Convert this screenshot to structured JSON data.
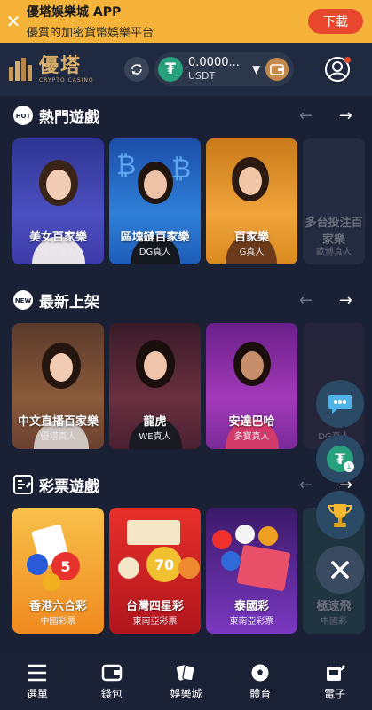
{
  "banner": {
    "title": "優塔娛樂城 APP",
    "subtitle": "優質的加密貨幣娛樂平台",
    "download_label": "下載"
  },
  "header": {
    "brand_name": "優塔",
    "brand_tagline": "CRYPTO CASINO",
    "balance": "0.0000...",
    "currency": "USDT"
  },
  "sections": [
    {
      "title": "熱門遊戲",
      "badge": "HOT",
      "cards": [
        {
          "name": "美女百家樂",
          "provider": "優塔真人",
          "bg": "#3b3fa8"
        },
        {
          "name": "區塊鏈百家樂",
          "provider": "DG真人",
          "bg": "#1f5fb8"
        },
        {
          "name": "百家樂",
          "provider": "G真人",
          "bg": "#d98a1f"
        },
        {
          "name": "多台投注百家樂",
          "provider": "歐博真人",
          "bg": "#3a3f55"
        }
      ]
    },
    {
      "title": "最新上架",
      "badge": "NEW",
      "cards": [
        {
          "name": "中文直播百家樂",
          "provider": "優塔真人",
          "bg": "#7a4a2e"
        },
        {
          "name": "龍虎",
          "provider": "WE真人",
          "bg": "#5a2a3a"
        },
        {
          "name": "安達巴哈",
          "provider": "多寶真人",
          "bg": "#8a2fa0"
        },
        {
          "name": "",
          "provider": "DG真人",
          "bg": "#3a2f45"
        }
      ]
    },
    {
      "title": "彩票遊戲",
      "badge": "",
      "cards": [
        {
          "name": "香港六合彩",
          "provider": "中國彩票",
          "bg": "#f0a52b"
        },
        {
          "name": "台灣四星彩",
          "provider": "東南亞彩票",
          "bg": "#d8202a"
        },
        {
          "name": "泰國彩",
          "provider": "東南亞彩票",
          "bg": "#6a2fb0"
        },
        {
          "name": "極速飛",
          "provider": "中國彩",
          "bg": "#2f5a55"
        }
      ]
    }
  ],
  "nav": [
    {
      "label": "選單",
      "icon": "menu-icon"
    },
    {
      "label": "錢包",
      "icon": "wallet-icon"
    },
    {
      "label": "娛樂城",
      "icon": "cards-icon"
    },
    {
      "label": "體育",
      "icon": "soccer-icon"
    },
    {
      "label": "電子",
      "icon": "slot-machine-icon"
    }
  ],
  "colors": {
    "background": "#1a2135",
    "banner": "#f5b33a",
    "download": "#e8462d",
    "gold": "#d8ad6a",
    "tether": "#26a17b"
  }
}
